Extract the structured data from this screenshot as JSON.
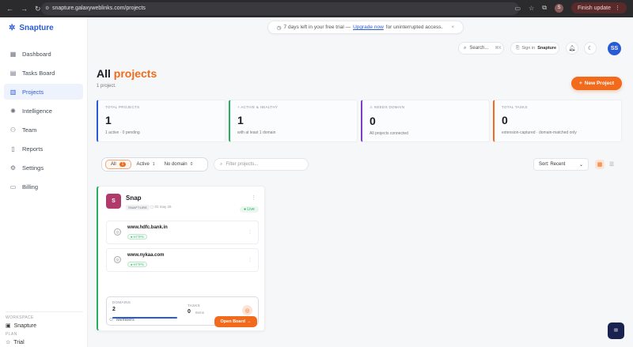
{
  "browser": {
    "url": "snapture.galaxyweblinks.com/projects",
    "profile_initial": "S",
    "finish_update": "Finish update"
  },
  "sidebar": {
    "brand": "Snapture",
    "items": [
      {
        "label": "Dashboard"
      },
      {
        "label": "Tasks Board"
      },
      {
        "label": "Projects"
      },
      {
        "label": "Intelligence"
      },
      {
        "label": "Team"
      },
      {
        "label": "Reports"
      },
      {
        "label": "Settings"
      },
      {
        "label": "Billing"
      }
    ],
    "workspace_label": "WORKSPACE",
    "workspace_value": "Snapture",
    "plan_label": "PLAN",
    "plan_value": "Trial"
  },
  "banner": {
    "text_before": "7 days left in your free trial —",
    "link": "Upgrade now",
    "text_after": "for uninterrupted access.",
    "close": "×"
  },
  "topbar": {
    "search_label": "Search...",
    "search_kbd": "⌘K",
    "signin_prefix": "Sign in",
    "signin_app": "Snapture",
    "avatar": "SS"
  },
  "page": {
    "title_prefix": "All",
    "title_accent": "projects",
    "subtitle": "1 project.",
    "new_project": "New Project"
  },
  "stats": [
    {
      "label": "TOTAL PROJECTS",
      "value": "1",
      "desc": "1 active · 0 pending",
      "color": "#2a5bd7"
    },
    {
      "label": "ACTIVE & HEALTHY",
      "value": "1",
      "desc": "with at least 1 domain",
      "color": "#27ae60"
    },
    {
      "label": "NEEDS DOMAIN",
      "value": "0",
      "desc": "All projects connected",
      "color": "#7b3fc9"
    },
    {
      "label": "TOTAL TASKS",
      "value": "0",
      "desc": "extension-captured · domain-matched only",
      "color": "#f26a1b"
    }
  ],
  "filters": {
    "chips": [
      {
        "label": "All",
        "count": "1"
      },
      {
        "label": "Active",
        "count": "1"
      },
      {
        "label": "No domain",
        "count": "0"
      }
    ],
    "placeholder": "Filter projects...",
    "sort_label": "Sort: Recent"
  },
  "project": {
    "initial": "S",
    "name": "Snap",
    "tag": "SNAPTURE",
    "date": "01 may 26",
    "status": "Live",
    "domains": [
      {
        "name": "www.hdfc.bank.in",
        "badge": "HTTPS"
      },
      {
        "name": "www.nykaa.com",
        "badge": "HTTPS"
      }
    ],
    "domains_label": "DOMAINS",
    "domains_value": "2",
    "domains_progress": 1.0,
    "tasks_label": "TASKS",
    "tasks_value": "0",
    "tasks_unit": "Items",
    "members_label": "Members",
    "open_board": "Open Board"
  },
  "colors": {
    "accent": "#f26a1b",
    "brand": "#2a5bd7"
  }
}
